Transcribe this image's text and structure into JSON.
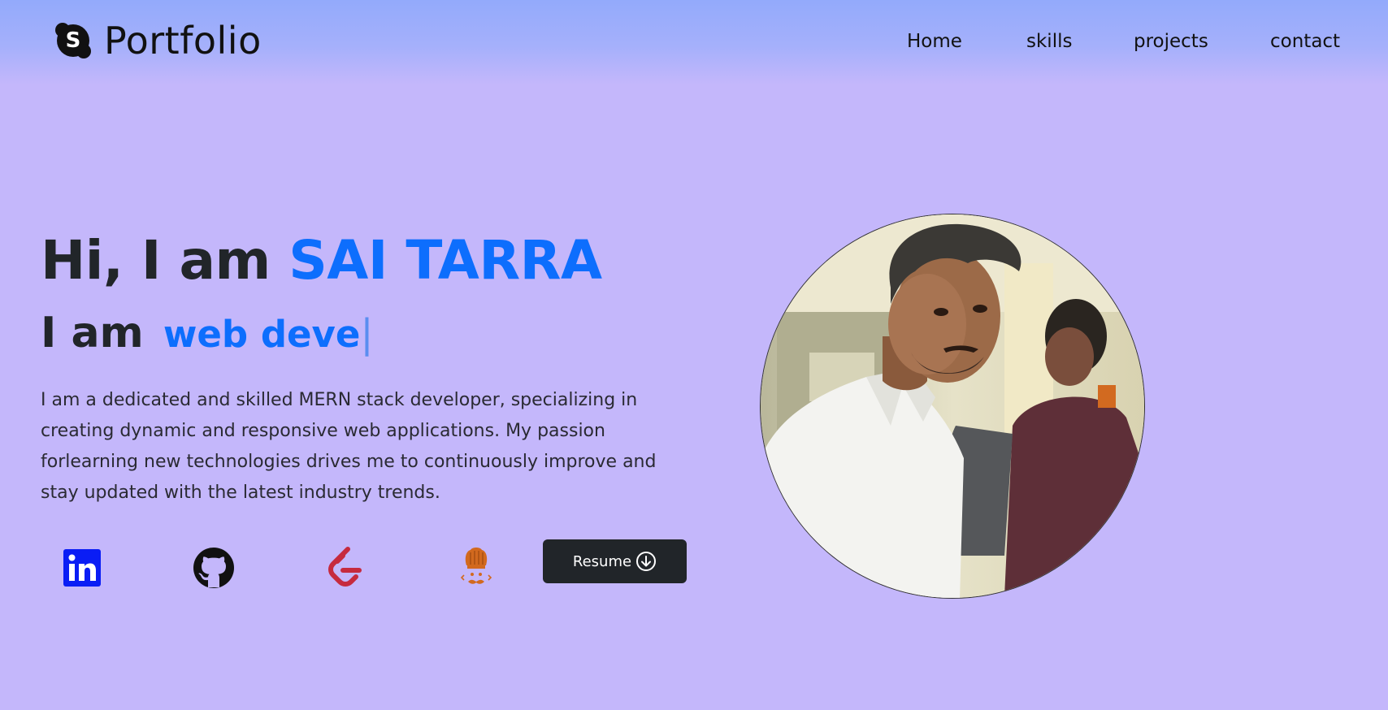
{
  "navbar": {
    "brand": {
      "icon": "skype-icon",
      "text": "Portfolio"
    },
    "links": [
      {
        "label": "Home"
      },
      {
        "label": "skills"
      },
      {
        "label": "projects"
      },
      {
        "label": "contact"
      }
    ]
  },
  "hero": {
    "greeting": "Hi, I am ",
    "name": "SAI TARRA",
    "sub_prefix": "I am",
    "typed_text": "web deve",
    "cursor": "|",
    "bio": "I am a dedicated and skilled MERN stack developer, specializing in creating dynamic and responsive web applications. My passion forlearning new technologies drives me to continuously improve and stay updated with the latest industry trends.",
    "socials": [
      {
        "icon": "linkedin-icon",
        "color": "#0a1df5"
      },
      {
        "icon": "github-icon",
        "color": "#111111"
      },
      {
        "icon": "leetcode-icon",
        "color": "#c62a3e"
      },
      {
        "icon": "codechef-icon",
        "color": "#d2691e"
      }
    ],
    "resume_button": {
      "label": "Resume",
      "icon": "download-circle-icon"
    },
    "profile_photo": "profile-photo"
  },
  "colors": {
    "background": "#c4b7fb",
    "navbar_top": "#93aafb",
    "accent": "#0d6efd",
    "button_dark": "#212529"
  }
}
